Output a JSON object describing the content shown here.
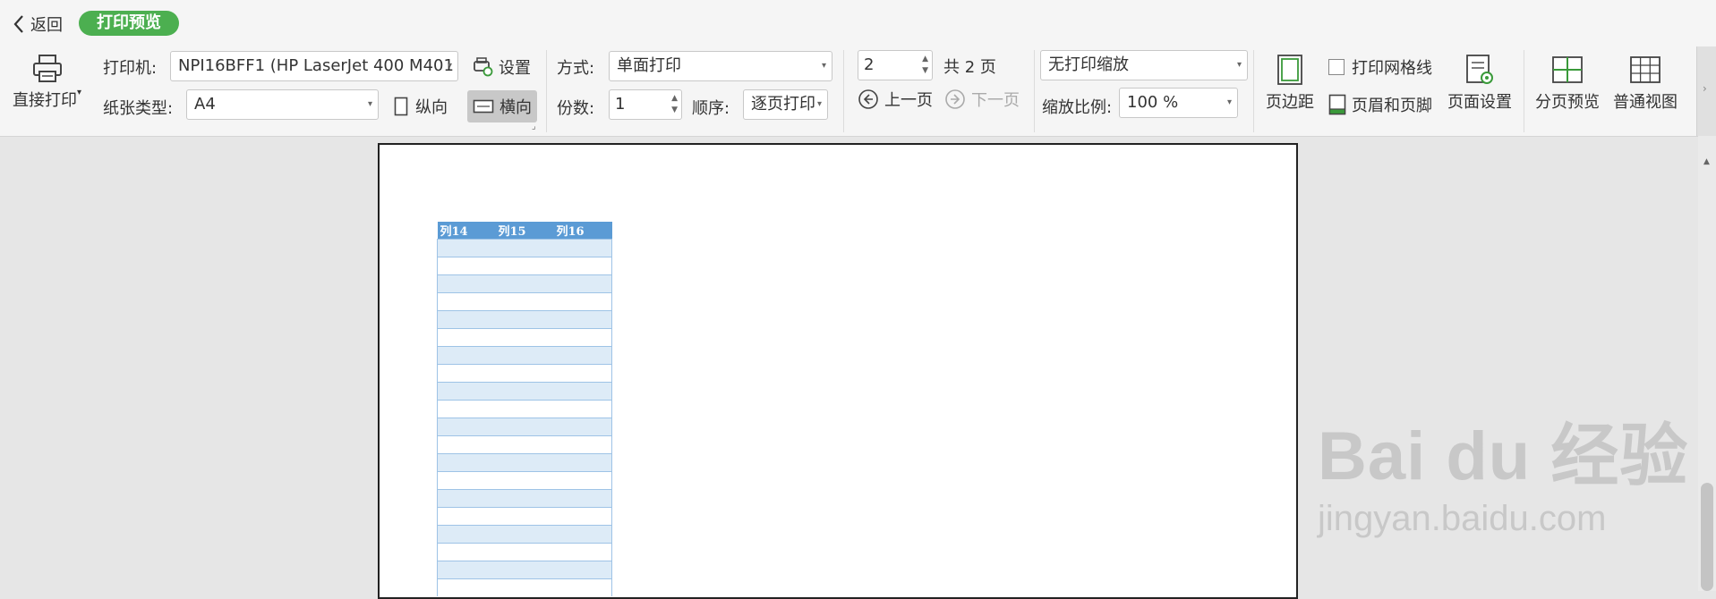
{
  "header": {
    "back_label": "返回",
    "mode_pill": "打印预览"
  },
  "print": {
    "direct_print_label": "直接打印",
    "printer_label": "打印机:",
    "printer_value": "NPI16BFF1 (HP LaserJet 400 M401",
    "settings_label": "设置",
    "paper_label": "纸张类型:",
    "paper_value": "A4",
    "portrait_label": "纵向",
    "landscape_label": "横向"
  },
  "mode": {
    "method_label": "方式:",
    "method_value": "单面打印",
    "copies_label": "份数:",
    "copies_value": "1",
    "order_label": "顺序:",
    "order_value": "逐页打印"
  },
  "paging": {
    "current_page": "2",
    "total_label": "共 2 页",
    "prev_label": "上一页",
    "next_label": "下一页"
  },
  "scale": {
    "scale_mode_value": "无打印缩放",
    "ratio_label": "缩放比例:",
    "ratio_value": "100 %"
  },
  "tools": {
    "margin_label": "页边距",
    "gridlines_label": "打印网格线",
    "header_footer_label": "页眉和页脚",
    "page_setup_label": "页面设置",
    "page_break_label": "分页预览",
    "normal_view_label": "普通视图"
  },
  "sheet": {
    "columns": [
      "列14",
      "列15",
      "列16"
    ]
  },
  "watermark": {
    "logo_text": "Bai du 经验",
    "url_text": "jingyan.baidu.com"
  },
  "colors": {
    "accent_green": "#4caf50",
    "table_header": "#5b9bd5",
    "table_band": "#ddebf7"
  }
}
